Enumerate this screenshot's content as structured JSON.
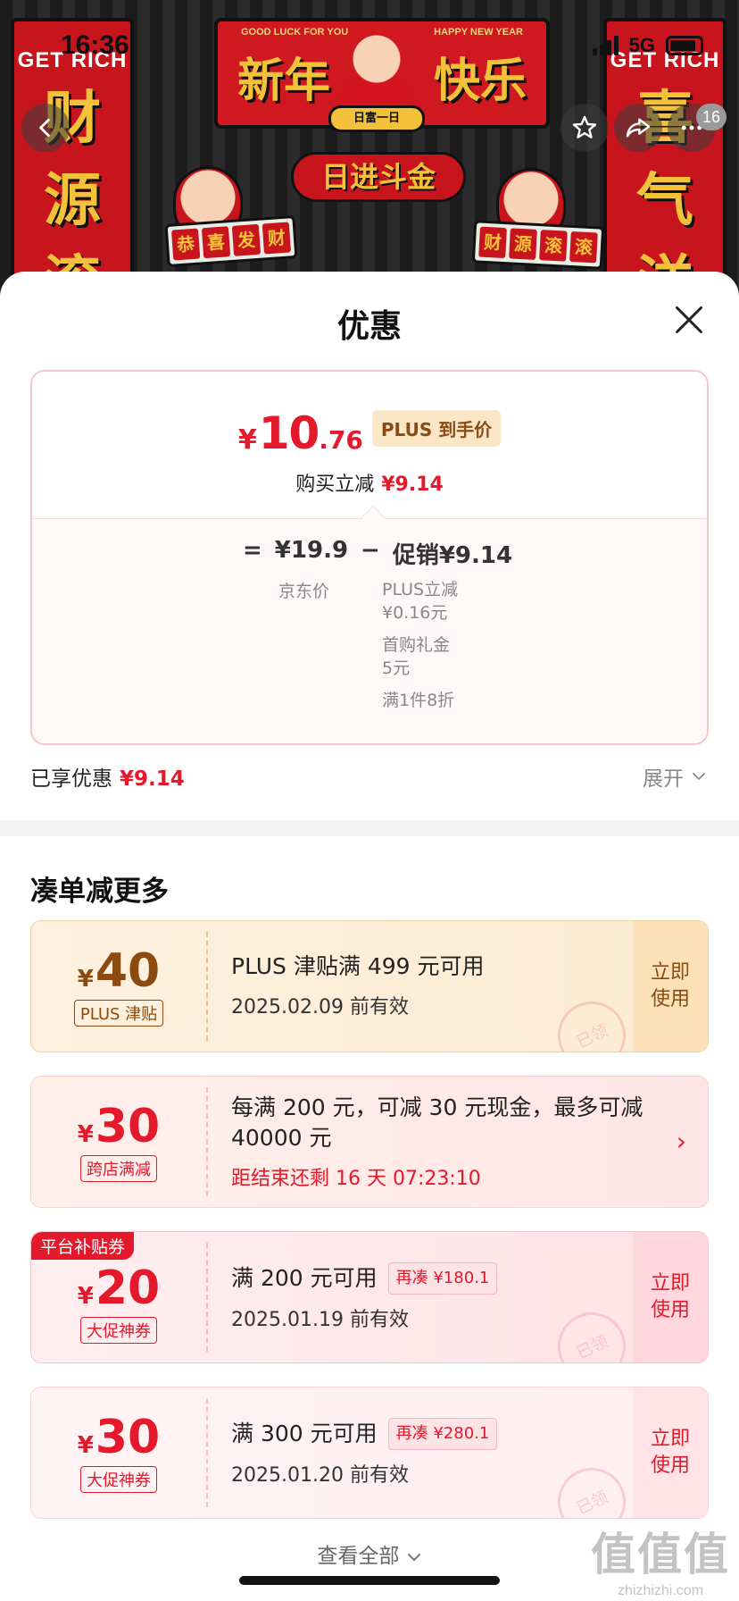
{
  "status_bar": {
    "time": "16:36",
    "network": "5G"
  },
  "nav": {
    "badge_count": "16"
  },
  "banner": {
    "left_couplet_en": "GET RICH",
    "left_couplet": [
      "财",
      "源",
      "滚"
    ],
    "right_couplet_en": "GET RICH",
    "right_couplet": [
      "喜",
      "气",
      "洋"
    ],
    "board_small_left": "GOOD LUCK FOR YOU",
    "board_small_right": "HAPPY NEW YEAR",
    "board_left": "新年",
    "board_right": "快乐",
    "day_tag": "日富一日",
    "center_sticker": "日进斗金",
    "sticker_left": [
      "恭",
      "喜",
      "发",
      "财"
    ],
    "sticker_right": [
      "财",
      "源",
      "滚",
      "滚"
    ]
  },
  "sheet": {
    "title": "优惠"
  },
  "price_card": {
    "currency": "¥",
    "price_int": "10",
    "price_dec": ".76",
    "plus_tag": "PLUS 到手价",
    "instant_cut_label": "购买立减",
    "instant_cut_value": "¥9.14",
    "eq_sign": "=",
    "jd_price": "¥19.9",
    "minus_sign": "−",
    "promo_total": "促销¥9.14",
    "jd_price_label": "京东价",
    "promos": [
      {
        "line1": "PLUS立减",
        "line2": "¥0.16元"
      },
      {
        "line1": "首购礼金",
        "line2": "5元"
      },
      {
        "line1": "满1件8折",
        "line2": ""
      }
    ]
  },
  "enjoyed": {
    "label": "已享优惠",
    "value": "¥9.14",
    "expand_label": "展开"
  },
  "more_section": {
    "title": "凑单减更多"
  },
  "coupons": [
    {
      "currency": "¥",
      "amount": "40",
      "type": "PLUS 津贴",
      "title": "PLUS 津贴满 499 元可用",
      "date": "2025.02.09 前有效",
      "action": [
        "立即",
        "使用"
      ],
      "stamp": "已领"
    },
    {
      "currency": "¥",
      "amount": "30",
      "type": "跨店满减",
      "title": "每满 200 元，可减 30 元现金，最多可减 40000 元",
      "date": "距结束还剩 16 天 07:23:10"
    },
    {
      "currency": "¥",
      "amount": "20",
      "type": "大促神券",
      "badge": "平台补贴券",
      "title": "满 200 元可用",
      "add_more": "再凑 ¥180.1",
      "date": "2025.01.19 前有效",
      "action": [
        "立即",
        "使用"
      ],
      "stamp": "已领"
    },
    {
      "currency": "¥",
      "amount": "30",
      "type": "大促神券",
      "title": "满 300 元可用",
      "add_more": "再凑 ¥280.1",
      "date": "2025.01.20 前有效",
      "action": [
        "立即",
        "使用"
      ],
      "stamp": "已领"
    }
  ],
  "footer": {
    "view_all": "查看全部"
  },
  "watermark": {
    "big": "值值值",
    "small": "zhizhizhi.com"
  },
  "colors": {
    "accent_red": "#e4192c",
    "plus_gold": "#8a4a10"
  }
}
